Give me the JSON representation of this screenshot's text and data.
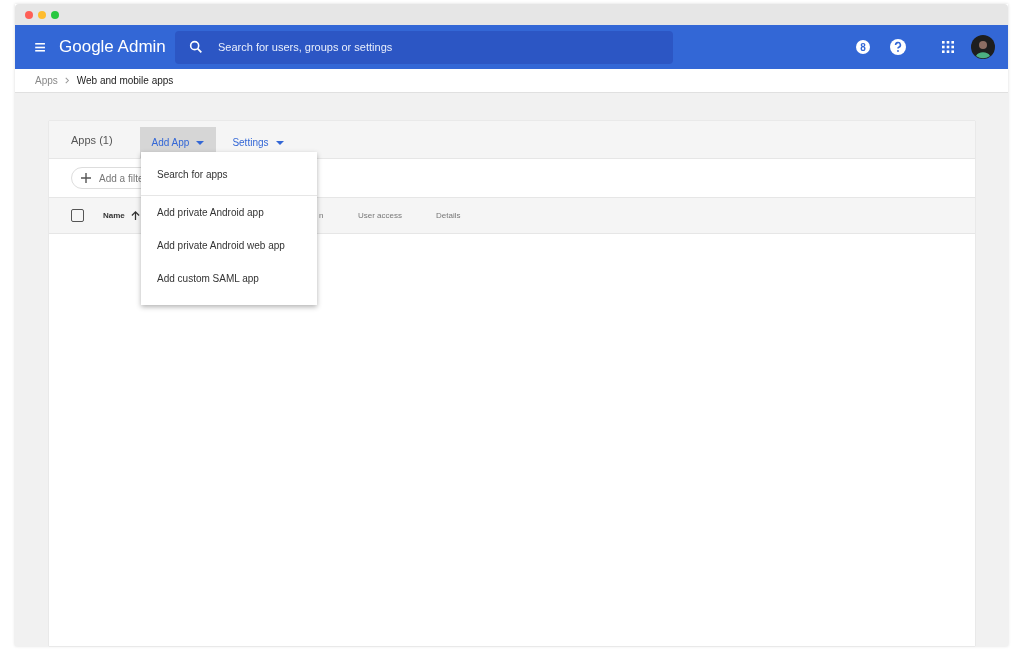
{
  "header": {
    "menu_glyph": "≡",
    "product": "Google Admin",
    "search": {
      "placeholder": "Search for users, groups or settings"
    },
    "notification_count": "8"
  },
  "breadcrumb": [
    "Apps",
    "Web and mobile apps"
  ],
  "toolbar": {
    "title": "Apps (1)",
    "menus": [
      {
        "label": "Add App",
        "expanded": true
      },
      {
        "label": "Settings",
        "expanded": false
      }
    ]
  },
  "filter": {
    "label": "Add a filte"
  },
  "table": {
    "select_all": {
      "checked": false
    },
    "columns": [
      {
        "label": "Name",
        "sorted": true
      },
      {
        "label": "n",
        "sorted": false
      },
      {
        "label": "User access",
        "sorted": false
      },
      {
        "label": "Details",
        "sorted": false
      }
    ]
  },
  "dropdown": {
    "groups": [
      [
        "Search for apps"
      ],
      [
        "Add private Android app",
        "Add private Android web app",
        "Add custom SAML app"
      ]
    ]
  }
}
